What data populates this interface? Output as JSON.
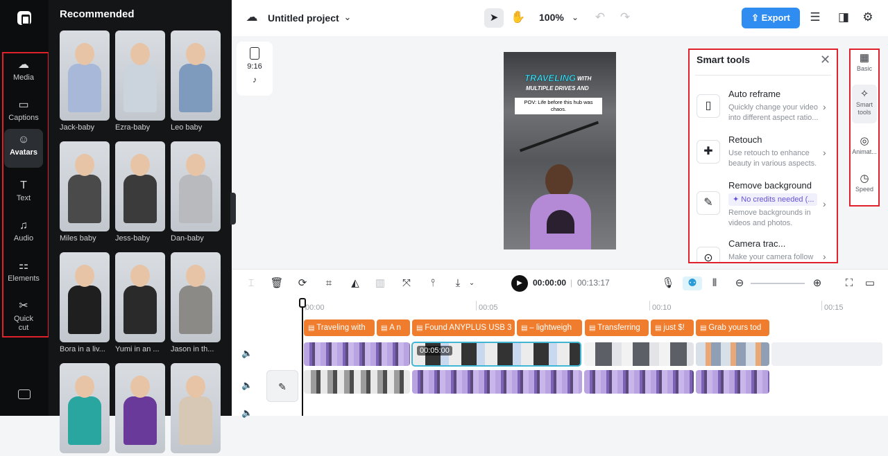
{
  "nav": {
    "items": [
      {
        "label": "Media",
        "icon": "media-icon"
      },
      {
        "label": "Captions",
        "icon": "captions-icon"
      },
      {
        "label": "Avatars",
        "icon": "avatars-icon"
      },
      {
        "label": "Text",
        "icon": "text-icon"
      },
      {
        "label": "Audio",
        "icon": "audio-icon"
      },
      {
        "label": "Elements",
        "icon": "elements-icon"
      },
      {
        "label": "Quick cut",
        "icon": "quick-cut-icon"
      }
    ],
    "active": "Avatars"
  },
  "panel": {
    "title": "Recommended",
    "avatars": [
      {
        "name": "Jack-baby",
        "color": "#a7b8d8"
      },
      {
        "name": "Ezra-baby",
        "color": "#cbd3dd"
      },
      {
        "name": "Leo baby",
        "color": "#7e9bbd"
      },
      {
        "name": "Miles baby",
        "color": "#4a4a4a"
      },
      {
        "name": "Jess-baby",
        "color": "#3b3b3b"
      },
      {
        "name": "Dan-baby",
        "color": "#b9babd"
      },
      {
        "name": "Bora in a liv...",
        "color": "#1f1f1f"
      },
      {
        "name": "Yumi in an ...",
        "color": "#2a2a2a"
      },
      {
        "name": "Jason in th...",
        "color": "#8c8a86"
      },
      {
        "name": "",
        "color": "#2aa6a0"
      },
      {
        "name": "",
        "color": "#6a3a9a"
      },
      {
        "name": "",
        "color": "#d7c8b6"
      }
    ]
  },
  "topbar": {
    "project_title": "Untitled project",
    "zoom": "100%",
    "export_label": "Export"
  },
  "canvas": {
    "ratio": "9:16",
    "video_title1": "TRAVELING",
    "video_title2": "WITH",
    "video_title3": "MULTIPLE DRIVES AND",
    "video_caption": "POV: Life before this hub was chaos."
  },
  "smart_tools": {
    "title": "Smart tools",
    "tools": [
      {
        "name": "Auto reframe",
        "desc": "Quickly change your video into different aspect ratio...",
        "icon": "reframe-icon"
      },
      {
        "name": "Retouch",
        "desc": "Use retouch to enhance beauty in various aspects.",
        "icon": "retouch-icon"
      },
      {
        "name": "Remove background",
        "badge": "✦ No credits needed (...",
        "desc": "Remove backgrounds in videos and photos.",
        "icon": "remove-bg-icon"
      },
      {
        "name": "Camera trac...",
        "desc": "Make your camera follow t...",
        "icon": "camera-track-icon"
      }
    ]
  },
  "right_tabs": [
    {
      "label": "Basic",
      "icon": "basic-icon"
    },
    {
      "label": "Smart tools",
      "icon": "magic-wand-icon"
    },
    {
      "label": "Animat...",
      "icon": "animation-icon"
    },
    {
      "label": "Speed",
      "icon": "speed-icon"
    }
  ],
  "timeline": {
    "current_time": "00:00:00",
    "total_time": "00:13:17",
    "ruler": [
      "00:00",
      "00:05",
      "00:10",
      "00:15"
    ],
    "selected_clip_time": "00:05:00",
    "text_clips": [
      "Traveling with",
      "A n",
      "Found ANYPLUS USB 3",
      "– lightweigh",
      "Transferring",
      "just $!",
      "Grab yours tod"
    ]
  },
  "colors": {
    "accent": "#2f8cf0",
    "highlight_box": "#e0202a",
    "text_clip": "#ef7d2d",
    "selection": "#3fb6d6"
  }
}
